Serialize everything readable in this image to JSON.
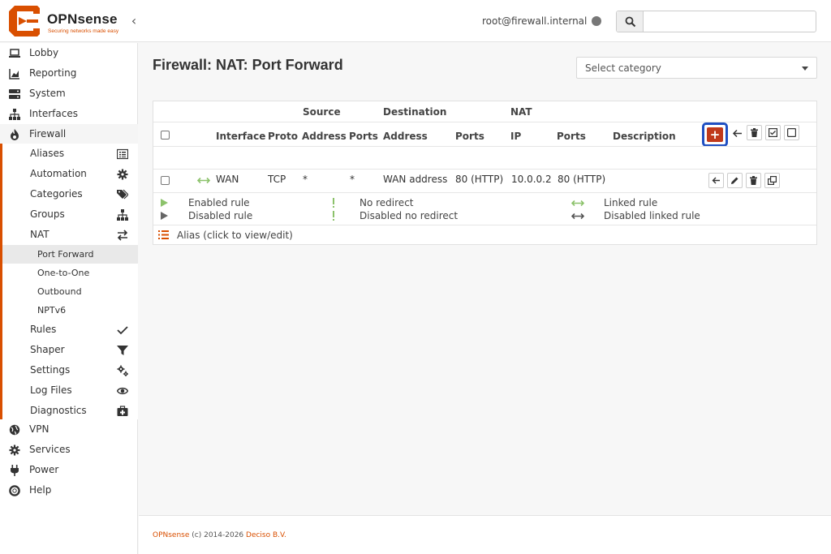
{
  "header": {
    "brand_name": "OPNsense",
    "brand_tagline": "Securing networks made easy",
    "collapse_glyph": "‹",
    "user": "root@firewall.internal",
    "search_placeholder": "",
    "search_icon": "search-icon"
  },
  "sidebar": {
    "items": [
      {
        "label": "Lobby",
        "icon": "laptop-icon"
      },
      {
        "label": "Reporting",
        "icon": "area-chart-icon"
      },
      {
        "label": "System",
        "icon": "server-icon"
      },
      {
        "label": "Interfaces",
        "icon": "sitemap-icon"
      },
      {
        "label": "Firewall",
        "icon": "fire-icon"
      },
      {
        "label": "VPN",
        "icon": "globe-icon"
      },
      {
        "label": "Services",
        "icon": "cog-icon"
      },
      {
        "label": "Power",
        "icon": "plug-icon"
      },
      {
        "label": "Help",
        "icon": "life-ring-icon"
      }
    ],
    "firewall_sub": [
      {
        "label": "Aliases",
        "icon": "list-alt-icon"
      },
      {
        "label": "Automation",
        "icon": "cog-icon"
      },
      {
        "label": "Categories",
        "icon": "tags-icon"
      },
      {
        "label": "Groups",
        "icon": "sitemap-icon"
      },
      {
        "label": "NAT",
        "icon": "exchange-icon"
      },
      {
        "label": "Rules",
        "icon": "check-icon"
      },
      {
        "label": "Shaper",
        "icon": "filter-icon"
      },
      {
        "label": "Settings",
        "icon": "cogs-icon"
      },
      {
        "label": "Log Files",
        "icon": "eye-icon"
      },
      {
        "label": "Diagnostics",
        "icon": "medkit-icon"
      }
    ],
    "nat_sub": [
      {
        "label": "Port Forward",
        "active": true
      },
      {
        "label": "One-to-One",
        "active": false
      },
      {
        "label": "Outbound",
        "active": false
      },
      {
        "label": "NPTv6",
        "active": false
      }
    ]
  },
  "main": {
    "title": "Firewall: NAT: Port Forward",
    "category_select": "Select category"
  },
  "table": {
    "group_headers": {
      "source": "Source",
      "destination": "Destination",
      "nat": "NAT"
    },
    "columns": {
      "interface": "Interface",
      "proto": "Proto",
      "src_address": "Address",
      "src_ports": "Ports",
      "dst_address": "Address",
      "dst_ports": "Ports",
      "nat_ip": "IP",
      "nat_ports": "Ports",
      "description": "Description"
    },
    "rows": [
      {
        "interface": "WAN",
        "proto": "TCP",
        "src_address": "*",
        "src_ports": "*",
        "dst_address": "WAN address",
        "dst_ports": "80 (HTTP)",
        "nat_ip": "10.0.0.2",
        "nat_ports": "80 (HTTP)",
        "description": ""
      }
    ]
  },
  "legend": {
    "enabled_rule": "Enabled rule",
    "disabled_rule": "Disabled rule",
    "no_redirect": "No redirect",
    "disabled_no_redirect": "Disabled no redirect",
    "linked_rule": "Linked rule",
    "disabled_linked_rule": "Disabled linked rule",
    "alias": "Alias (click to view/edit)"
  },
  "footer": {
    "product": "OPNsense",
    "copyright": " (c) 2014-2026 ",
    "company": "Deciso B.V."
  },
  "colors": {
    "brand_orange": "#d94f00",
    "add_button": "#c0391b",
    "highlight_border": "#1f4fc2",
    "linked_green": "#8cc26b"
  }
}
